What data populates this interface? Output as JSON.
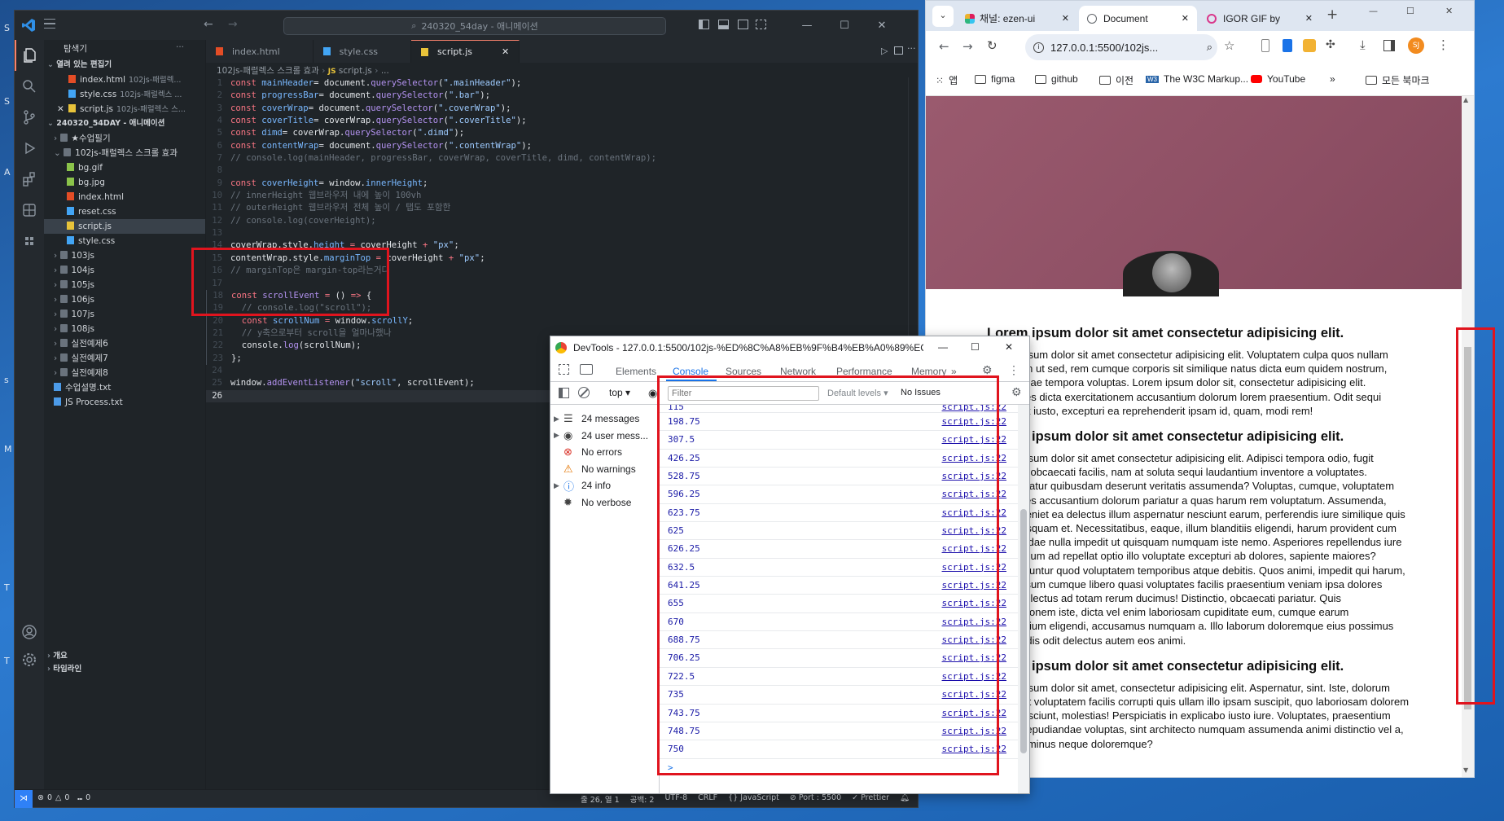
{
  "desktop": {
    "glyphs": [
      "S",
      "S",
      "A",
      "s",
      "M",
      "T",
      "T"
    ]
  },
  "vscode": {
    "title_search": "240320_54day - 애니메이션",
    "explorer_title": "탐색기",
    "open_editors_header": "열려 있는 편집기",
    "open_editors": [
      {
        "name": "index.html",
        "path": "102js-패럴렉..."
      },
      {
        "name": "style.css",
        "path": "102js-패럴렉스 ..."
      },
      {
        "name": "script.js",
        "path": "102js-패럴렉스 스..."
      }
    ],
    "workspace_header": "240320_54DAY - 애니메이션",
    "tree": [
      {
        "label": "★수업필기",
        "type": "folder",
        "indent": 1,
        "open": false
      },
      {
        "label": "102js-패럴렉스 스크롤 효과",
        "type": "folder",
        "indent": 1,
        "open": true
      },
      {
        "label": "bg.gif",
        "type": "img",
        "indent": 2
      },
      {
        "label": "bg.jpg",
        "type": "img",
        "indent": 2
      },
      {
        "label": "index.html",
        "type": "html",
        "indent": 2
      },
      {
        "label": "reset.css",
        "type": "css",
        "indent": 2
      },
      {
        "label": "script.js",
        "type": "js",
        "indent": 2,
        "selected": true
      },
      {
        "label": "style.css",
        "type": "css",
        "indent": 2
      },
      {
        "label": "103js",
        "type": "folder",
        "indent": 1,
        "open": false
      },
      {
        "label": "104js",
        "type": "folder",
        "indent": 1,
        "open": false
      },
      {
        "label": "105js",
        "type": "folder",
        "indent": 1,
        "open": false
      },
      {
        "label": "106js",
        "type": "folder",
        "indent": 1,
        "open": false
      },
      {
        "label": "107js",
        "type": "folder",
        "indent": 1,
        "open": false
      },
      {
        "label": "108js",
        "type": "folder",
        "indent": 1,
        "open": false
      },
      {
        "label": "실전예제6",
        "type": "folder",
        "indent": 1,
        "open": false
      },
      {
        "label": "실전예제7",
        "type": "folder",
        "indent": 1,
        "open": false
      },
      {
        "label": "실전예제8",
        "type": "folder",
        "indent": 1,
        "open": false
      },
      {
        "label": "수업설명.txt",
        "type": "txt",
        "indent": 1
      },
      {
        "label": "JS Process.txt",
        "type": "txt",
        "indent": 1
      }
    ],
    "outline_label": "개요",
    "timeline_label": "타임라인",
    "tabs": [
      {
        "label": "index.html",
        "active": false
      },
      {
        "label": "style.css",
        "active": false
      },
      {
        "label": "script.js",
        "active": true
      }
    ],
    "breadcrumb": [
      "102js-패럴렉스 스크롤 효과",
      "script.js",
      "..."
    ],
    "code_lines": [
      [
        [
          "kw",
          "const "
        ],
        [
          "vr",
          "mainHeader"
        ],
        [
          "",
          "= document."
        ],
        [
          "fn",
          "querySelector"
        ],
        [
          "",
          "("
        ],
        [
          "st",
          "\".mainHeader\""
        ],
        [
          "",
          ");"
        ]
      ],
      [
        [
          "kw",
          "const "
        ],
        [
          "vr",
          "progressBar"
        ],
        [
          "",
          "= document."
        ],
        [
          "fn",
          "querySelector"
        ],
        [
          "",
          "("
        ],
        [
          "st",
          "\".bar\""
        ],
        [
          "",
          ");"
        ]
      ],
      [
        [
          "kw",
          "const "
        ],
        [
          "vr",
          "coverWrap"
        ],
        [
          "",
          "= document."
        ],
        [
          "fn",
          "querySelector"
        ],
        [
          "",
          "("
        ],
        [
          "st",
          "\".coverWrap\""
        ],
        [
          "",
          ");"
        ]
      ],
      [
        [
          "kw",
          "const "
        ],
        [
          "vr",
          "coverTitle"
        ],
        [
          "",
          "= coverWrap."
        ],
        [
          "fn",
          "querySelector"
        ],
        [
          "",
          "("
        ],
        [
          "st",
          "\".coverTitle\""
        ],
        [
          "",
          ");"
        ]
      ],
      [
        [
          "kw",
          "const "
        ],
        [
          "vr",
          "dimd"
        ],
        [
          "",
          "= coverWrap."
        ],
        [
          "fn",
          "querySelector"
        ],
        [
          "",
          "("
        ],
        [
          "st",
          "\".dimd\""
        ],
        [
          "",
          ");"
        ]
      ],
      [
        [
          "kw",
          "const "
        ],
        [
          "vr",
          "contentWrap"
        ],
        [
          "",
          "= document."
        ],
        [
          "fn",
          "querySelector"
        ],
        [
          "",
          "("
        ],
        [
          "st",
          "\".contentWrap\""
        ],
        [
          "",
          ");"
        ]
      ],
      [
        [
          "cm",
          "// console.log(mainHeader, progressBar, coverWrap, coverTitle, dimd, contentWrap);"
        ]
      ],
      [],
      [
        [
          "kw",
          "const "
        ],
        [
          "vr",
          "coverHeight"
        ],
        [
          "",
          "= window."
        ],
        [
          "pr",
          "innerHeight"
        ],
        [
          "",
          ";"
        ]
      ],
      [
        [
          "cm",
          "// innerHeight 웹브라우저 내에 높이 100vh"
        ]
      ],
      [
        [
          "cm",
          "// outerHeight 웹브라우저 전체 높이 / 탭도 포함한"
        ]
      ],
      [
        [
          "cm",
          "// console.log(coverHeight);"
        ]
      ],
      [],
      [
        [
          "",
          "coverWrap.style."
        ],
        [
          "pr",
          "height"
        ],
        [
          "",
          ""
        ],
        [
          "kw",
          " = "
        ],
        [
          "",
          "coverHeight "
        ],
        [
          "kw",
          "+ "
        ],
        [
          "st",
          "\"px\""
        ],
        [
          "",
          ";"
        ]
      ],
      [
        [
          "",
          "contentWrap.style."
        ],
        [
          "pr",
          "marginTop"
        ],
        [
          "kw",
          " = "
        ],
        [
          "",
          "coverHeight "
        ],
        [
          "kw",
          "+ "
        ],
        [
          "st",
          "\"px\""
        ],
        [
          "",
          ";"
        ]
      ],
      [
        [
          "cm",
          "// marginTop은 margin-top라는거다"
        ]
      ],
      [],
      [
        [
          "kw",
          "const "
        ],
        [
          "fn",
          "scrollEvent"
        ],
        [
          "kw",
          " = "
        ],
        [
          "",
          "() "
        ],
        [
          "kw",
          "=>"
        ],
        [
          "",
          " {"
        ]
      ],
      [
        [
          "cm",
          "  // console.log(\"scroll\");"
        ]
      ],
      [
        [
          "kw",
          "  const "
        ],
        [
          "vr",
          "scrollNum"
        ],
        [
          "kw",
          " = "
        ],
        [
          "",
          "window."
        ],
        [
          "pr",
          "scrollY"
        ],
        [
          "",
          ";"
        ]
      ],
      [
        [
          "cm",
          "  // y축으로부터 scroll을 얼마나했나"
        ]
      ],
      [
        [
          "",
          "  console."
        ],
        [
          "fn",
          "log"
        ],
        [
          "",
          "(scrollNum);"
        ]
      ],
      [
        [
          "",
          "};"
        ]
      ],
      [],
      [
        [
          "",
          "window."
        ],
        [
          "fn",
          "addEventListener"
        ],
        [
          "",
          "("
        ],
        [
          "st",
          "\"scroll\""
        ],
        [
          "",
          ", scrollEvent);"
        ]
      ],
      []
    ],
    "status": {
      "errors": "0",
      "warnings": "0",
      "ports": "0",
      "cursor": "줄 26, 열 1",
      "spaces": "공백: 2",
      "encoding": "UTF-8",
      "eol": "CRLF",
      "language": "JavaScript",
      "port": "Port : 5500",
      "prettier": "Prettier"
    }
  },
  "chrome": {
    "tabs": [
      {
        "label": "채널: ezen-ui",
        "active": false
      },
      {
        "label": "Document",
        "active": true
      },
      {
        "label": "IGOR GIF by",
        "active": false
      }
    ],
    "url": "127.0.0.1:5500/102js...",
    "profile_initials": "SJ",
    "bookmarks": [
      "앱",
      "figma",
      "github",
      "이전",
      "The W3C Markup...",
      "YouTube"
    ],
    "all_bookmarks": "모든 북마크",
    "sections": [
      {
        "title": "Lorem ipsum dolor sit amet consectetur adipisicing elit.",
        "body": "Lorem ipsum dolor sit amet consectetur adipisicing elit. Voluptatem culpa quos nullam quisquam ut sed, rem cumque corporis sit similique natus dicta eum quidem nostrum, recusandae tempora voluptas. Lorem ipsum dolor sit, consectetur adipisicing elit. Voluptates dicta exercitationem accusantium dolorum lorem praesentium. Odit sequi facilis est iusto, excepturi ea reprehenderit ipsam id, quam, modi rem!"
      },
      {
        "title": "Lorem ipsum dolor sit amet consectetur adipisicing elit.",
        "body": "Lorem ipsum dolor sit amet consectetur adipisicing elit. Adipisci tempora odio, fugit cumque, obcaecati facilis, nam at soluta sequi laudantium inventore a voluptates. Consequatur quibusdam deserunt veritatis assumenda? Voluptas, cumque, voluptatem asperiores accusantium dolorum pariatur a quas harum rem voluptatum. Assumenda, porro eveniet ea delectus illum aspernatur nesciunt earum, perferendis iure similique quis dicta quisquam et. Necessitatibus, eaque, illum blanditiis eligendi, harum provident cum repudiandae nulla impedit ut quisquam numquam iste nemo. Asperiores repellendus iure praesentium ad repellat optio illo voluptate excepturi ab dolores, sapiente maiores? Consequuntur quod voluptatem temporibus atque debitis. Quos animi, impedit qui harum, officia ipsum cumque libero quasi voluptates facilis praesentium veniam ipsa dolores fugiat, delectus ad totam rerum ducimus! Distinctio, obcaecati pariatur. Quis exercitationem iste, dicta vel enim laboriosam cupiditate eum, cumque earum accusantium eligendi, accusamus numquam a. Illo laborum doloremque eius possimus perferendis odit delectus autem eos animi."
      },
      {
        "title": "Lorem ipsum dolor sit amet consectetur adipisicing elit.",
        "body": "Lorem ipsum dolor sit amet, consectetur adipisicing elit. Aspernatur, sint. Iste, dolorum porro sint voluptatem facilis corrupti quis ullam illo ipsam suscipit, quo laboriosam dolorem velit? Nesciunt, molestias! Perspiciatis in explicabo iusto iure. Voluptates, praesentium fugiat. Repudiandae voluptas, sint architecto numquam assumenda animi distinctio vel a, maiores minus neque doloremque?"
      }
    ]
  },
  "devtools": {
    "title": "DevTools - 127.0.0.1:5500/102js-%ED%8C%A8%EB%9F%B4%EB%A0%89%EC...",
    "panels": [
      "Elements",
      "Console",
      "Sources",
      "Network",
      "Performance",
      "Memory"
    ],
    "context": "top",
    "filter_placeholder": "Filter",
    "levels": "Default levels ▾",
    "issues": "No Issues",
    "sidebar": [
      {
        "label": "24 messages",
        "icon": "list"
      },
      {
        "label": "24 user mess...",
        "icon": "user"
      },
      {
        "label": "No errors",
        "icon": "error"
      },
      {
        "label": "No warnings",
        "icon": "warning"
      },
      {
        "label": "24 info",
        "icon": "info"
      },
      {
        "label": "No verbose",
        "icon": "bug"
      }
    ],
    "source": "script.js:22",
    "log_values": [
      "115",
      "198.75",
      "307.5",
      "426.25",
      "528.75",
      "596.25",
      "623.75",
      "625",
      "626.25",
      "632.5",
      "641.25",
      "655",
      "670",
      "688.75",
      "706.25",
      "722.5",
      "735",
      "743.75",
      "748.75",
      "750"
    ],
    "prompt": ">"
  },
  "colors": {
    "highlight": "#e0141e",
    "vscode_bg": "#1f2428",
    "chrome_tab": "#dee6f1",
    "devtools_blue": "#1a73e8"
  }
}
